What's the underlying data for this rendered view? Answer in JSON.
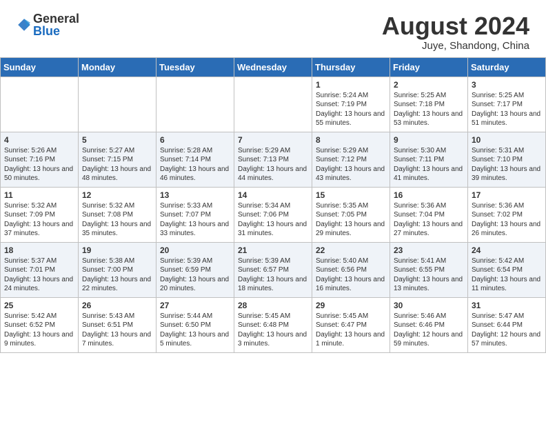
{
  "header": {
    "logo_general": "General",
    "logo_blue": "Blue",
    "month_year": "August 2024",
    "location": "Juye, Shandong, China"
  },
  "weekdays": [
    "Sunday",
    "Monday",
    "Tuesday",
    "Wednesday",
    "Thursday",
    "Friday",
    "Saturday"
  ],
  "weeks": [
    [
      {
        "day": "",
        "content": ""
      },
      {
        "day": "",
        "content": ""
      },
      {
        "day": "",
        "content": ""
      },
      {
        "day": "",
        "content": ""
      },
      {
        "day": "1",
        "content": "Sunrise: 5:24 AM\nSunset: 7:19 PM\nDaylight: 13 hours\nand 55 minutes."
      },
      {
        "day": "2",
        "content": "Sunrise: 5:25 AM\nSunset: 7:18 PM\nDaylight: 13 hours\nand 53 minutes."
      },
      {
        "day": "3",
        "content": "Sunrise: 5:25 AM\nSunset: 7:17 PM\nDaylight: 13 hours\nand 51 minutes."
      }
    ],
    [
      {
        "day": "4",
        "content": "Sunrise: 5:26 AM\nSunset: 7:16 PM\nDaylight: 13 hours\nand 50 minutes."
      },
      {
        "day": "5",
        "content": "Sunrise: 5:27 AM\nSunset: 7:15 PM\nDaylight: 13 hours\nand 48 minutes."
      },
      {
        "day": "6",
        "content": "Sunrise: 5:28 AM\nSunset: 7:14 PM\nDaylight: 13 hours\nand 46 minutes."
      },
      {
        "day": "7",
        "content": "Sunrise: 5:29 AM\nSunset: 7:13 PM\nDaylight: 13 hours\nand 44 minutes."
      },
      {
        "day": "8",
        "content": "Sunrise: 5:29 AM\nSunset: 7:12 PM\nDaylight: 13 hours\nand 43 minutes."
      },
      {
        "day": "9",
        "content": "Sunrise: 5:30 AM\nSunset: 7:11 PM\nDaylight: 13 hours\nand 41 minutes."
      },
      {
        "day": "10",
        "content": "Sunrise: 5:31 AM\nSunset: 7:10 PM\nDaylight: 13 hours\nand 39 minutes."
      }
    ],
    [
      {
        "day": "11",
        "content": "Sunrise: 5:32 AM\nSunset: 7:09 PM\nDaylight: 13 hours\nand 37 minutes."
      },
      {
        "day": "12",
        "content": "Sunrise: 5:32 AM\nSunset: 7:08 PM\nDaylight: 13 hours\nand 35 minutes."
      },
      {
        "day": "13",
        "content": "Sunrise: 5:33 AM\nSunset: 7:07 PM\nDaylight: 13 hours\nand 33 minutes."
      },
      {
        "day": "14",
        "content": "Sunrise: 5:34 AM\nSunset: 7:06 PM\nDaylight: 13 hours\nand 31 minutes."
      },
      {
        "day": "15",
        "content": "Sunrise: 5:35 AM\nSunset: 7:05 PM\nDaylight: 13 hours\nand 29 minutes."
      },
      {
        "day": "16",
        "content": "Sunrise: 5:36 AM\nSunset: 7:04 PM\nDaylight: 13 hours\nand 27 minutes."
      },
      {
        "day": "17",
        "content": "Sunrise: 5:36 AM\nSunset: 7:02 PM\nDaylight: 13 hours\nand 26 minutes."
      }
    ],
    [
      {
        "day": "18",
        "content": "Sunrise: 5:37 AM\nSunset: 7:01 PM\nDaylight: 13 hours\nand 24 minutes."
      },
      {
        "day": "19",
        "content": "Sunrise: 5:38 AM\nSunset: 7:00 PM\nDaylight: 13 hours\nand 22 minutes."
      },
      {
        "day": "20",
        "content": "Sunrise: 5:39 AM\nSunset: 6:59 PM\nDaylight: 13 hours\nand 20 minutes."
      },
      {
        "day": "21",
        "content": "Sunrise: 5:39 AM\nSunset: 6:57 PM\nDaylight: 13 hours\nand 18 minutes."
      },
      {
        "day": "22",
        "content": "Sunrise: 5:40 AM\nSunset: 6:56 PM\nDaylight: 13 hours\nand 16 minutes."
      },
      {
        "day": "23",
        "content": "Sunrise: 5:41 AM\nSunset: 6:55 PM\nDaylight: 13 hours\nand 13 minutes."
      },
      {
        "day": "24",
        "content": "Sunrise: 5:42 AM\nSunset: 6:54 PM\nDaylight: 13 hours\nand 11 minutes."
      }
    ],
    [
      {
        "day": "25",
        "content": "Sunrise: 5:42 AM\nSunset: 6:52 PM\nDaylight: 13 hours\nand 9 minutes."
      },
      {
        "day": "26",
        "content": "Sunrise: 5:43 AM\nSunset: 6:51 PM\nDaylight: 13 hours\nand 7 minutes."
      },
      {
        "day": "27",
        "content": "Sunrise: 5:44 AM\nSunset: 6:50 PM\nDaylight: 13 hours\nand 5 minutes."
      },
      {
        "day": "28",
        "content": "Sunrise: 5:45 AM\nSunset: 6:48 PM\nDaylight: 13 hours\nand 3 minutes."
      },
      {
        "day": "29",
        "content": "Sunrise: 5:45 AM\nSunset: 6:47 PM\nDaylight: 13 hours\nand 1 minute."
      },
      {
        "day": "30",
        "content": "Sunrise: 5:46 AM\nSunset: 6:46 PM\nDaylight: 12 hours\nand 59 minutes."
      },
      {
        "day": "31",
        "content": "Sunrise: 5:47 AM\nSunset: 6:44 PM\nDaylight: 12 hours\nand 57 minutes."
      }
    ]
  ]
}
